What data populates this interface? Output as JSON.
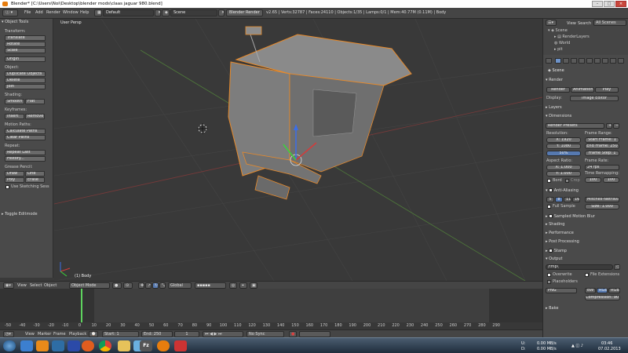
{
  "window": {
    "title": "Blender* [C:\\Users\\Noi\\Desktop\\blender mods\\claas jaguar 980.blend]",
    "min": "–",
    "max": "□",
    "close": "×"
  },
  "topbar": {
    "menus": [
      "File",
      "Add",
      "Render",
      "Window",
      "Help"
    ],
    "screen_layout": "Default",
    "scene": "Scene",
    "engine": "Blender Render",
    "stats": "v2.65 | Verts:32787 | Faces:24110 | Objects:1/35 | Lamps:0/1 | Mem:40.77M (0.11M) | Body"
  },
  "toolshelf": {
    "title": "Object Tools",
    "transform": {
      "label": "Transform:",
      "buttons": [
        "Translate",
        "Rotate",
        "Scale"
      ],
      "origin": "Origin"
    },
    "object": {
      "label": "Object:",
      "buttons": [
        "Duplicate Objects",
        "Delete",
        "Join"
      ]
    },
    "shading": {
      "label": "Shading:",
      "smooth": "Smooth",
      "flat": "Flat"
    },
    "keyframes": {
      "label": "Keyframes:",
      "insert": "Insert",
      "remove": "Remove"
    },
    "motion_paths": {
      "label": "Motion Paths:",
      "calculate": "Calculate Paths",
      "clear": "Clear Paths"
    },
    "repeat": {
      "label": "Repeat:",
      "last": "Repeat Last",
      "history": "History..."
    },
    "grease_pencil": {
      "label": "Grease Pencil:",
      "draw": "Draw",
      "line": "Line",
      "poly": "Poly",
      "erase": "Erase",
      "sketching": "Use Sketching Sess"
    },
    "toggle": "Toggle Editmode"
  },
  "viewport": {
    "label": "User Persp",
    "object_label": "(1) Body"
  },
  "viewport_header": {
    "menus": [
      "View",
      "Select",
      "Object"
    ],
    "mode": "Object Mode",
    "orientation": "Global"
  },
  "timeline": {
    "ticks": [
      "-50",
      "-40",
      "-30",
      "-20",
      "-10",
      "0",
      "10",
      "20",
      "30",
      "40",
      "50",
      "60",
      "70",
      "80",
      "90",
      "100",
      "110",
      "120",
      "130",
      "140",
      "150",
      "160",
      "170",
      "180",
      "190",
      "200",
      "210",
      "220",
      "230",
      "240",
      "250",
      "260",
      "270",
      "280",
      "290"
    ],
    "current_frame_value": 1,
    "menus": [
      "View",
      "Marker",
      "Frame",
      "Playback"
    ],
    "start": "Start: 1",
    "end": "End: 250",
    "current": "1",
    "sync": "No Sync"
  },
  "outliner": {
    "menus": [
      "View",
      "Search"
    ],
    "filter": "All Scenes",
    "items": [
      "Scene",
      "RenderLayers",
      "World",
      "pit"
    ]
  },
  "properties": {
    "breadcrumb": "Scene",
    "render_panel": {
      "title": "Render",
      "render": "Render",
      "animation": "Animation",
      "play": "Play",
      "display_label": "Display:",
      "display": "Image Editor"
    },
    "layers": "Layers",
    "dimensions": {
      "title": "Dimensions",
      "presets": "Render Presets",
      "resolution_label": "Resolution:",
      "res_x": "X: 1920",
      "res_y": "Y: 1080",
      "percent": "50%",
      "frame_range_label": "Frame Range:",
      "start": "Start Frame: 1",
      "end": "End Frame: 250",
      "step": "Frame Step: 1",
      "aspect_label": "Aspect Ratio:",
      "asp_x": "X: 1.000",
      "asp_y": "Y: 1.000",
      "frame_rate_label": "Frame Rate:",
      "fps": "24 fps",
      "time_remap_label": "Time Remapping:",
      "remap_old": "100",
      "remap_new": "100",
      "border": "Bord",
      "crop": "Crop"
    },
    "anti_aliasing": {
      "title": "Anti-Aliasing",
      "samples": [
        "5",
        "8",
        "11",
        "16"
      ],
      "selected": "8",
      "filter": "Mitchell-Netravali",
      "full_sample": "Full Sample",
      "size": "Size: 1.000"
    },
    "collapsed": [
      "Sampled Motion Blur",
      "Shading",
      "Performance",
      "Post Processing",
      "Stamp"
    ],
    "output": {
      "title": "Output",
      "path": "/tmp\\",
      "overwrite": "Overwrite",
      "file_ext": "File Extensions",
      "placeholders": "Placeholders",
      "format": "PNG",
      "bw": "BW",
      "rgb": "RGB",
      "rgba": "RGBA",
      "compression": "Compression: 90%"
    },
    "bake": "Bake"
  },
  "taskbar": {
    "up": "U:",
    "down": "D:",
    "up_rate": "0.00 MB/s",
    "down_rate": "0.00 MB/s",
    "time": "03:46",
    "date": "07.02.2013",
    "apps": [
      "windows-start",
      "internet-explorer",
      "vlc",
      "media",
      "firefox",
      "chrome",
      "explorer",
      "paint",
      "fz",
      "blender",
      "daemon"
    ]
  },
  "colors": {
    "accent_blue": "#5679b0",
    "selection_orange": "#e88a2a",
    "frame_green": "#5ed35e"
  }
}
